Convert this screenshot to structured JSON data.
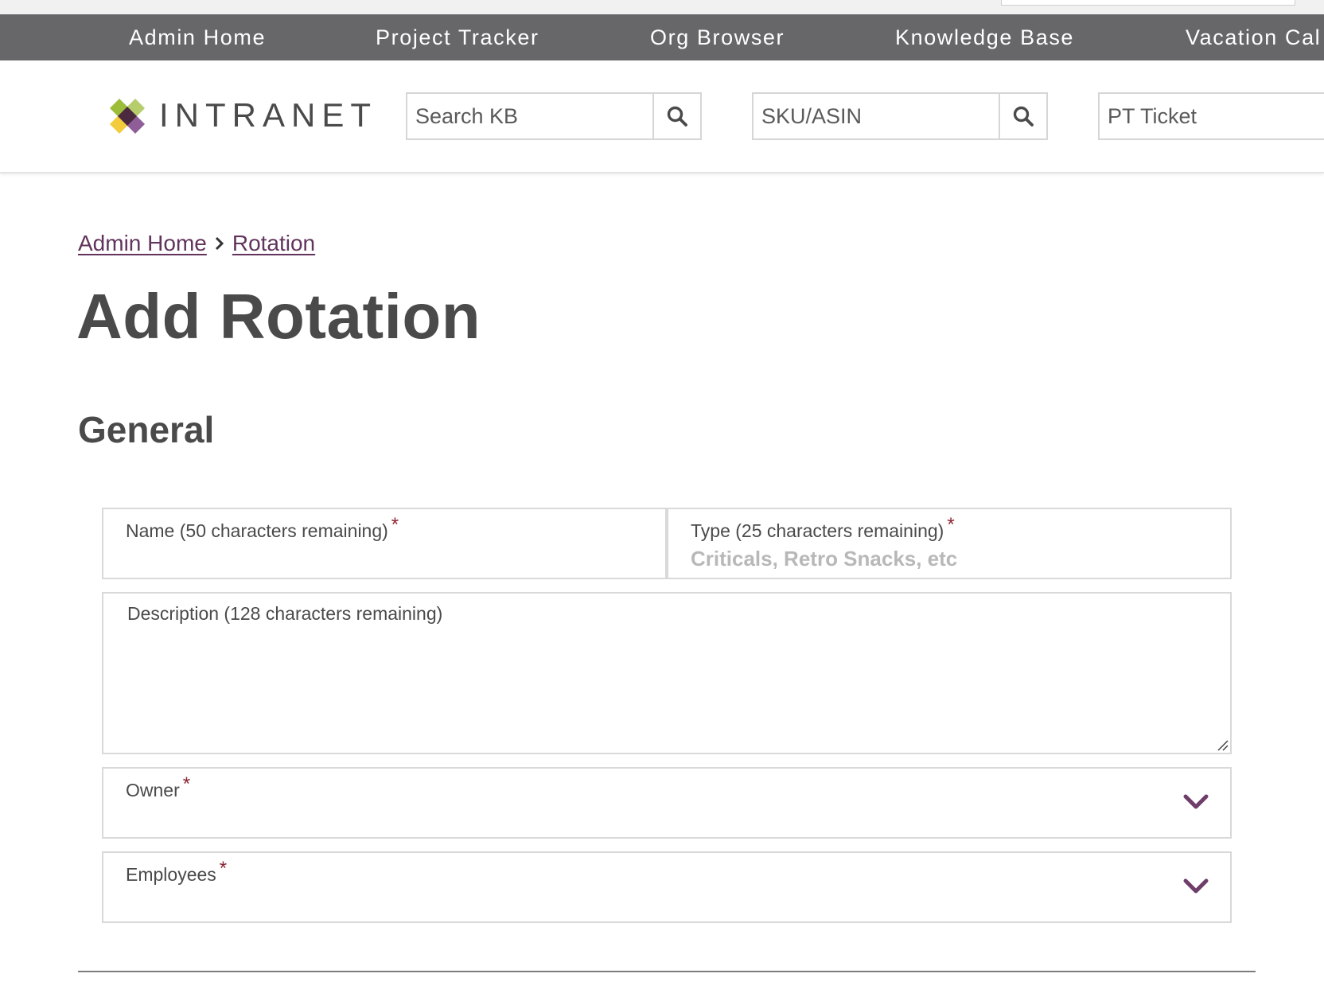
{
  "nav": {
    "items": [
      {
        "label": "Admin Home"
      },
      {
        "label": "Project Tracker"
      },
      {
        "label": "Org Browser"
      },
      {
        "label": "Knowledge Base"
      },
      {
        "label": "Vacation Cal"
      }
    ]
  },
  "header": {
    "logo_text": "INTRANET",
    "logo_icon": "intranet-logo-icon",
    "searches": [
      {
        "placeholder": "Search KB",
        "icon": "search-icon"
      },
      {
        "placeholder": "SKU/ASIN",
        "icon": "search-icon"
      },
      {
        "placeholder": "PT Ticket"
      }
    ]
  },
  "breadcrumb": {
    "items": [
      {
        "label": "Admin Home"
      },
      {
        "label": "Rotation"
      }
    ],
    "separator_icon": "chevron-right-icon"
  },
  "page": {
    "title": "Add Rotation",
    "section_title": "General"
  },
  "form": {
    "required_marker": "*",
    "name": {
      "label": "Name (50 characters remaining)",
      "value": "",
      "required": true
    },
    "type": {
      "label": "Type (25 characters remaining)",
      "placeholder": "Criticals, Retro Snacks, etc",
      "value": "",
      "required": true
    },
    "description": {
      "label": "Description (128 characters remaining)",
      "value": "",
      "required": false
    },
    "owner": {
      "label": "Owner",
      "required": true,
      "icon": "chevron-down-icon"
    },
    "employees": {
      "label": "Employees",
      "required": true,
      "icon": "chevron-down-icon"
    }
  },
  "colors": {
    "nav_bg": "#676769",
    "accent_purple": "#62335c",
    "chevron_purple": "#6e3e6a",
    "required_red": "#8b2331",
    "logo_green": "#9bbd3a",
    "logo_yellow": "#f2cc3c",
    "logo_purple": "#8f5d97",
    "logo_dark": "#4b2a3f"
  }
}
